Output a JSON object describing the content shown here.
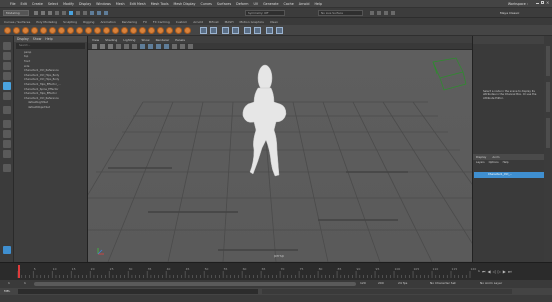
{
  "menubar": {
    "items": [
      "File",
      "Edit",
      "Create",
      "Select",
      "Modify",
      "Display",
      "Windows",
      "Mesh",
      "Edit Mesh",
      "Mesh Tools",
      "Mesh Display",
      "Curves",
      "Surfaces",
      "Deform",
      "UV",
      "Generate",
      "Cache",
      "Arnold",
      "Help"
    ],
    "workspace": "Workspace :",
    "workspace_value": "Maya Classic"
  },
  "statusline": {
    "mode": "Modeling",
    "search_placeholder": "Symmetry: Off",
    "live_surface": "No Live Surface"
  },
  "shelf": {
    "tabs": [
      "Curves / Surfaces",
      "Poly Modeling",
      "Sculpting",
      "Rigging",
      "Animation",
      "Rendering",
      "FX",
      "FX Caching",
      "Custom",
      "Arnold",
      "Bifrost",
      "MASH",
      "Motion Graphics",
      "XGen"
    ]
  },
  "outliner": {
    "header": [
      "Display",
      "Show",
      "Help"
    ],
    "search_placeholder": "Search...",
    "rows": [
      {
        "label": "persp",
        "indent": false
      },
      {
        "label": "top",
        "indent": false
      },
      {
        "label": "front",
        "indent": false
      },
      {
        "label": "side",
        "indent": false
      },
      {
        "label": "Character1_Ctrl_Reference",
        "indent": false
      },
      {
        "label": "Character1_Ctrl_Hips_Body",
        "indent": false
      },
      {
        "label": "Character1_Ctrl_Hips_Body",
        "indent": false
      },
      {
        "label": "Character1_Hips_Effector_...",
        "indent": false
      },
      {
        "label": "Character1_Spine_Effector",
        "indent": false
      },
      {
        "label": "Character1_Hips_Effector",
        "indent": false
      },
      {
        "label": "Character1_Ctrl_Reference",
        "indent": false
      },
      {
        "label": "defaultLightSet",
        "indent": true
      },
      {
        "label": "defaultObjectSet",
        "indent": true
      }
    ]
  },
  "viewport": {
    "menu": [
      "View",
      "Shading",
      "Lighting",
      "Show",
      "Renderer",
      "Panels"
    ],
    "camera_label": "persp",
    "fps": ""
  },
  "right_panel": {
    "message": "Select a node in the scene to display its attributes in the Channel Box. Or use the Attribute Editor.",
    "tabs": [
      "Display",
      "Anim"
    ],
    "layers_menu": [
      "Layers",
      "Options",
      "Help"
    ],
    "layer_name": "Character1_Ctrl_..."
  },
  "timeline": {
    "ticks": [
      "1",
      "5",
      "10",
      "15",
      "20",
      "25",
      "30",
      "35",
      "40",
      "45",
      "50",
      "55",
      "60",
      "65",
      "70",
      "75",
      "80",
      "85",
      "90",
      "95",
      "100",
      "105",
      "110",
      "115",
      "120"
    ],
    "current_frame": "1"
  },
  "range": {
    "start": "1",
    "start_inner": "1",
    "end_inner": "120",
    "end": "200",
    "fps": "24 fps",
    "character": "No Character Set",
    "anim_layer": "No Anim Layer"
  },
  "cmdline": {
    "lang": "MEL"
  },
  "colors": {
    "accent": "#4aa3df",
    "shelf_orange": "#d9823b",
    "viewport_bg": "#5f5f5f",
    "grid": "#4b4b4b",
    "timeline_marker": "#e03b3b"
  }
}
